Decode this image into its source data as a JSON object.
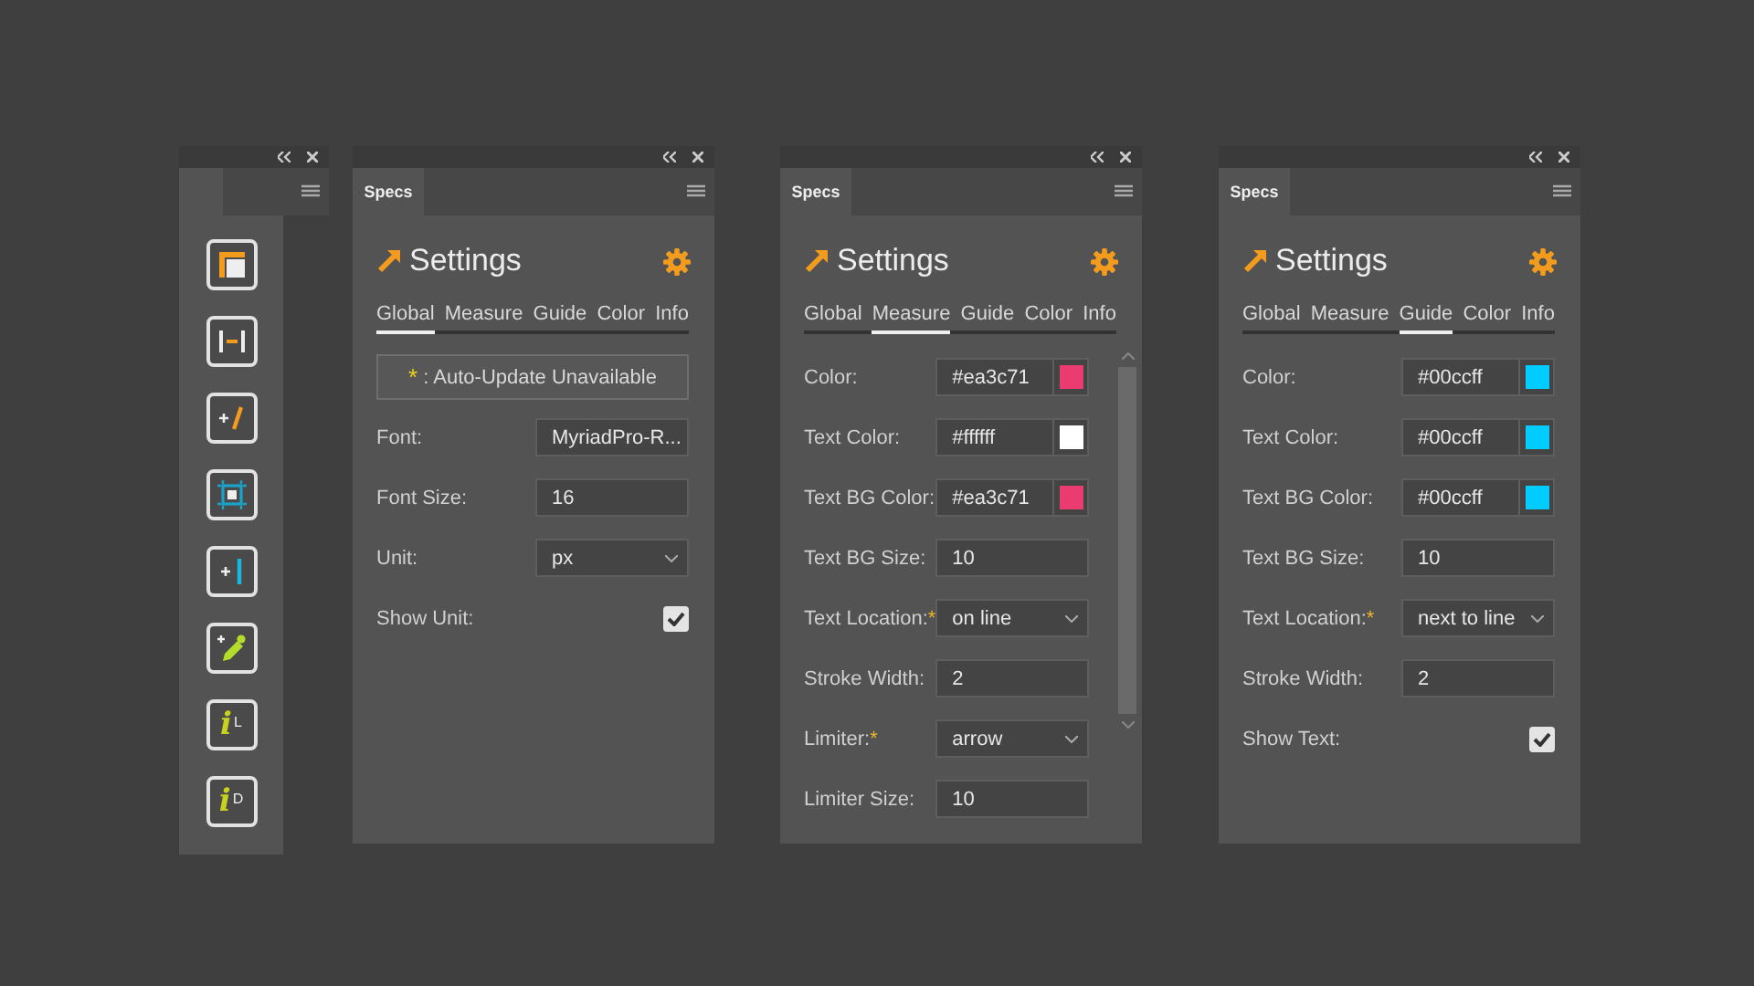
{
  "toolbar": {
    "tools": [
      {
        "kind": "artboard"
      },
      {
        "kind": "distance"
      },
      {
        "kind": "add-slash"
      },
      {
        "kind": "bounds"
      },
      {
        "kind": "add-bar"
      },
      {
        "kind": "eyedropper"
      },
      {
        "kind": "info",
        "glyph": "i",
        "letter": "L"
      },
      {
        "kind": "info",
        "glyph": "i",
        "letter": "D"
      }
    ]
  },
  "panels": [
    {
      "tab": "Specs",
      "title": "Settings",
      "scrollbar": false,
      "nav": [
        {
          "label": "Global",
          "selected": true
        },
        {
          "label": "Measure",
          "selected": false
        },
        {
          "label": "Guide",
          "selected": false
        },
        {
          "label": "Color",
          "selected": false
        },
        {
          "label": "Info",
          "selected": false
        }
      ],
      "rows": [
        {
          "kind": "notice",
          "marker": "*",
          "text": ": Auto-Update Unavailable"
        },
        {
          "kind": "text",
          "label": "Font:",
          "value": "MyriadPro-R..."
        },
        {
          "kind": "text",
          "label": "Font Size:",
          "value": "16"
        },
        {
          "kind": "select",
          "label": "Unit:",
          "value": "px"
        },
        {
          "kind": "checkbox",
          "label": "Show Unit:",
          "checked": true
        }
      ]
    },
    {
      "tab": "Specs",
      "title": "Settings",
      "scrollbar": true,
      "nav": [
        {
          "label": "Global",
          "selected": false
        },
        {
          "label": "Measure",
          "selected": true
        },
        {
          "label": "Guide",
          "selected": false
        },
        {
          "label": "Color",
          "selected": false
        },
        {
          "label": "Info",
          "selected": false
        }
      ],
      "rows": [
        {
          "kind": "color",
          "label": "Color:",
          "value": "#ea3c71",
          "color": "#ea3c71"
        },
        {
          "kind": "color",
          "label": "Text Color:",
          "value": "#ffffff",
          "color": "#ffffff"
        },
        {
          "kind": "color",
          "label": "Text BG Color:",
          "value": "#ea3c71",
          "color": "#ea3c71"
        },
        {
          "kind": "text",
          "label": "Text BG Size:",
          "value": "10"
        },
        {
          "kind": "select",
          "label": "Text Location:",
          "marker": "*",
          "value": "on line"
        },
        {
          "kind": "text",
          "label": "Stroke Width:",
          "value": "2"
        },
        {
          "kind": "select",
          "label": "Limiter:",
          "marker": "*",
          "value": "arrow"
        },
        {
          "kind": "text",
          "label": "Limiter Size:",
          "value": "10"
        }
      ]
    },
    {
      "tab": "Specs",
      "title": "Settings",
      "scrollbar": false,
      "nav": [
        {
          "label": "Global",
          "selected": false
        },
        {
          "label": "Measure",
          "selected": false
        },
        {
          "label": "Guide",
          "selected": true
        },
        {
          "label": "Color",
          "selected": false
        },
        {
          "label": "Info",
          "selected": false
        }
      ],
      "rows": [
        {
          "kind": "color",
          "label": "Color:",
          "value": "#00ccff",
          "color": "#00ccff"
        },
        {
          "kind": "color",
          "label": "Text Color:",
          "value": "#00ccff",
          "color": "#00ccff"
        },
        {
          "kind": "color",
          "label": "Text BG Color:",
          "value": "#00ccff",
          "color": "#00ccff"
        },
        {
          "kind": "text",
          "label": "Text BG Size:",
          "value": "10"
        },
        {
          "kind": "select",
          "label": "Text Location:",
          "marker": "*",
          "value": "next to line"
        },
        {
          "kind": "text",
          "label": "Stroke Width:",
          "value": "2"
        },
        {
          "kind": "checkbox",
          "label": "Show Text:",
          "checked": true
        }
      ]
    }
  ]
}
